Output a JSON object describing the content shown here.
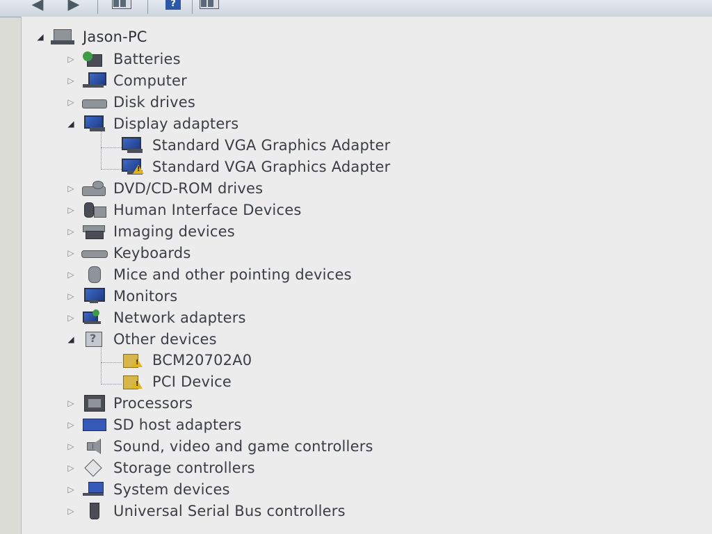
{
  "toolbar": {
    "back_icon": "back-arrow-icon",
    "forward_icon": "forward-arrow-icon",
    "show_hide_tree_icon": "show-hide-console-tree-icon",
    "help_icon": "help-icon",
    "action_pane_icon": "show-action-pane-icon"
  },
  "tree": {
    "root": {
      "label": "Jason-PC",
      "expanded": true,
      "icon": "computer-root-icon"
    },
    "items": [
      {
        "label": "Batteries",
        "expanded": false,
        "icon": "battery-icon"
      },
      {
        "label": "Computer",
        "expanded": false,
        "icon": "computer-icon"
      },
      {
        "label": "Disk drives",
        "expanded": false,
        "icon": "disk-drive-icon"
      },
      {
        "label": "Display adapters",
        "expanded": true,
        "icon": "display-adapter-icon",
        "children": [
          {
            "label": "Standard VGA Graphics Adapter",
            "icon": "display-adapter-icon",
            "warning": false
          },
          {
            "label": "Standard VGA Graphics Adapter",
            "icon": "display-adapter-warning-icon",
            "warning": true
          }
        ]
      },
      {
        "label": "DVD/CD-ROM drives",
        "expanded": false,
        "icon": "dvd-drive-icon"
      },
      {
        "label": "Human Interface Devices",
        "expanded": false,
        "icon": "hid-icon"
      },
      {
        "label": "Imaging devices",
        "expanded": false,
        "icon": "imaging-device-icon"
      },
      {
        "label": "Keyboards",
        "expanded": false,
        "icon": "keyboard-icon"
      },
      {
        "label": "Mice and other pointing devices",
        "expanded": false,
        "icon": "mouse-icon"
      },
      {
        "label": "Monitors",
        "expanded": false,
        "icon": "monitor-icon"
      },
      {
        "label": "Network adapters",
        "expanded": false,
        "icon": "network-adapter-icon"
      },
      {
        "label": "Other devices",
        "expanded": true,
        "icon": "unknown-device-icon",
        "children": [
          {
            "label": "BCM20702A0",
            "icon": "unknown-device-warning-icon",
            "warning": true
          },
          {
            "label": "PCI Device",
            "icon": "unknown-device-warning-icon",
            "warning": true
          }
        ]
      },
      {
        "label": "Processors",
        "expanded": false,
        "icon": "processor-icon"
      },
      {
        "label": "SD host adapters",
        "expanded": false,
        "icon": "sd-host-adapter-icon"
      },
      {
        "label": "Sound, video and game controllers",
        "expanded": false,
        "icon": "sound-icon"
      },
      {
        "label": "Storage controllers",
        "expanded": false,
        "icon": "storage-controller-icon"
      },
      {
        "label": "System devices",
        "expanded": false,
        "icon": "system-device-icon"
      },
      {
        "label": "Universal Serial Bus controllers",
        "expanded": false,
        "icon": "usb-icon"
      }
    ]
  },
  "colors": {
    "pane_background": "#ececec",
    "text": "#3b3e44",
    "warning": "#e2b51f",
    "adapter_blue": "#3659b8"
  }
}
